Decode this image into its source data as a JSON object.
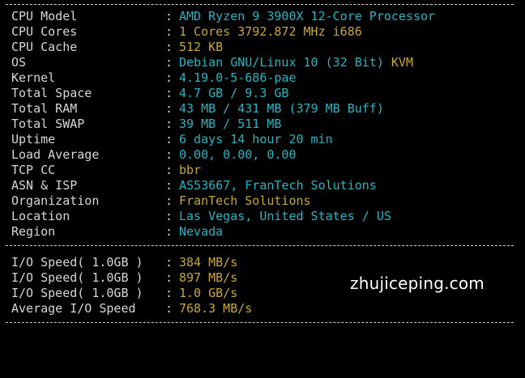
{
  "colors": {
    "background": "#000000",
    "label": "#d6d6d6",
    "cyan": "#21b6c4",
    "yellow": "#c8a82e"
  },
  "colon": ":",
  "system_info": {
    "cpu_model": {
      "label": "CPU Model",
      "value": "AMD Ryzen 9 3900X 12-Core Processor"
    },
    "cpu_cores": {
      "label": "CPU Cores",
      "value": "1 Cores 3792.872 MHz i686"
    },
    "cpu_cache": {
      "label": "CPU Cache",
      "value": "512 KB"
    },
    "os": {
      "label": "OS",
      "value": "Debian GNU/Linux 10 (32 Bit)",
      "virt": "KVM"
    },
    "kernel": {
      "label": "Kernel",
      "value": "4.19.0-5-686-pae"
    },
    "total_space": {
      "label": "Total Space",
      "used": "4.7 GB",
      "sep": " / ",
      "total": "9.3 GB"
    },
    "total_ram": {
      "label": "Total RAM",
      "used": "43 MB",
      "sep": " / ",
      "total": "431 MB",
      "buff": "(379 MB Buff)"
    },
    "total_swap": {
      "label": "Total SWAP",
      "used": "39 MB",
      "sep": " / ",
      "total": "511 MB"
    },
    "uptime": {
      "label": "Uptime",
      "value": "6 days 14 hour 20 min"
    },
    "load_average": {
      "label": "Load Average",
      "value": "0.00, 0.00, 0.00"
    },
    "tcp_cc": {
      "label": "TCP CC",
      "value": "bbr"
    },
    "asn_isp": {
      "label": "ASN & ISP",
      "value": "AS53667, FranTech Solutions"
    },
    "organization": {
      "label": "Organization",
      "value": "FranTech Solutions"
    },
    "location": {
      "label": "Location",
      "value": "Las Vegas, United States / US"
    },
    "region": {
      "label": "Region",
      "value": "Nevada"
    }
  },
  "io": {
    "runs": [
      {
        "label": "I/O Speed( 1.0GB )",
        "value": "384 MB/s"
      },
      {
        "label": "I/O Speed( 1.0GB )",
        "value": "897 MB/s"
      },
      {
        "label": "I/O Speed( 1.0GB )",
        "value": "1.0 GB/s"
      }
    ],
    "average": {
      "label": "Average I/O Speed",
      "value": "768.3 MB/s"
    }
  },
  "watermark": "zhujiceping.com"
}
